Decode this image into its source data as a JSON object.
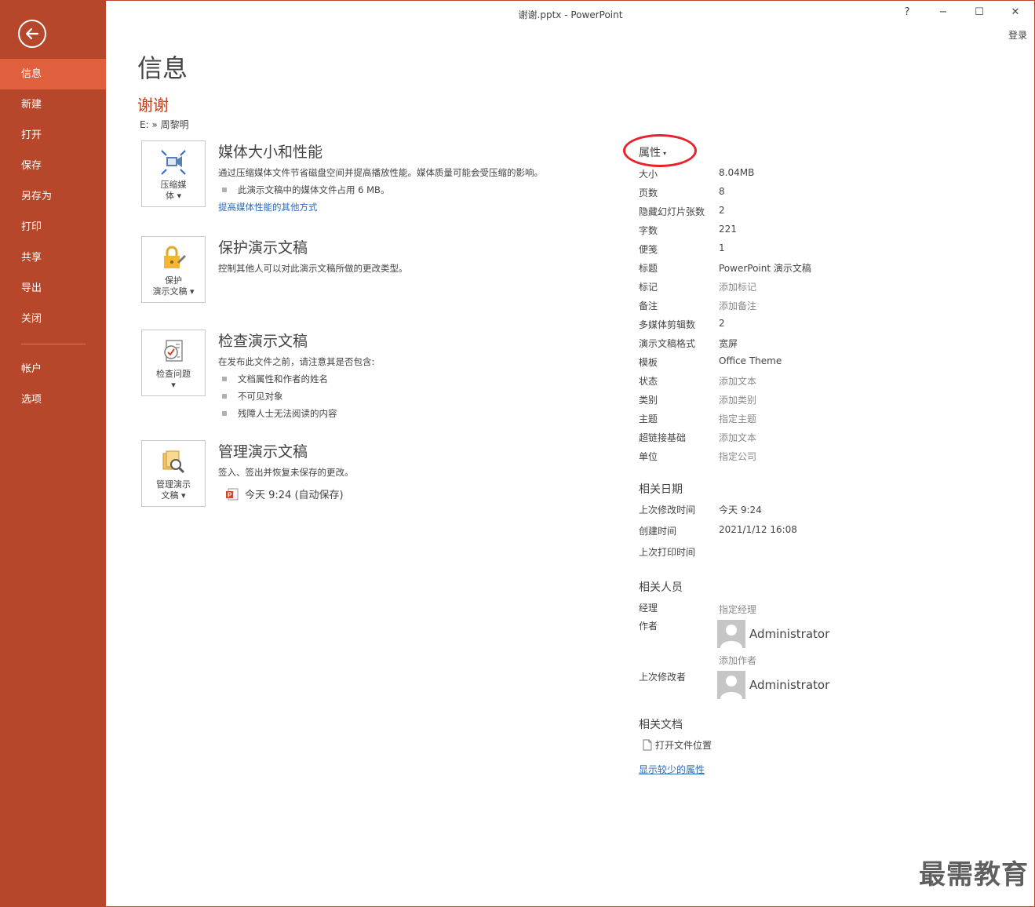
{
  "window": {
    "title": "谢谢.pptx - PowerPoint",
    "help": "?",
    "minimize": "−",
    "maximize": "☐",
    "close": "✕",
    "login": "登录"
  },
  "sidebar": {
    "items": [
      {
        "label": "信息"
      },
      {
        "label": "新建"
      },
      {
        "label": "打开"
      },
      {
        "label": "保存"
      },
      {
        "label": "另存为"
      },
      {
        "label": "打印"
      },
      {
        "label": "共享"
      },
      {
        "label": "导出"
      },
      {
        "label": "关闭"
      }
    ],
    "bottom_items": [
      {
        "label": "帐户"
      },
      {
        "label": "选项"
      }
    ]
  },
  "main": {
    "page_title": "信息",
    "doc_name": "谢谢",
    "doc_path": "E: » 周黎明",
    "sections": {
      "media": {
        "tile_label_1": "压缩媒",
        "tile_label_2": "体 ▾",
        "title": "媒体大小和性能",
        "desc": "通过压缩媒体文件节省磁盘空间并提高播放性能。媒体质量可能会受压缩的影响。",
        "bullet": "此演示文稿中的媒体文件占用 6 MB。",
        "link": "提高媒体性能的其他方式"
      },
      "protect": {
        "tile_label_1": "保护",
        "tile_label_2": "演示文稿 ▾",
        "title": "保护演示文稿",
        "desc": "控制其他人可以对此演示文稿所做的更改类型。"
      },
      "inspect": {
        "tile_label_1": "检查问题",
        "tile_label_2": "▾",
        "title": "检查演示文稿",
        "desc": "在发布此文件之前，请注意其是否包含:",
        "bullets": [
          "文档属性和作者的姓名",
          "不可见对象",
          "残障人士无法阅读的内容"
        ]
      },
      "manage": {
        "tile_label_1": "管理演示",
        "tile_label_2": "文稿 ▾",
        "title": "管理演示文稿",
        "desc": "签入、签出并恢复未保存的更改。",
        "autosave": "今天 9:24 (自动保存)"
      }
    }
  },
  "properties": {
    "header": "属性",
    "caret": "▾",
    "rows": [
      {
        "k": "大小",
        "v": "8.04MB"
      },
      {
        "k": "页数",
        "v": "8"
      },
      {
        "k": "隐藏幻灯片张数",
        "v": "2"
      },
      {
        "k": "字数",
        "v": "221"
      },
      {
        "k": "便笺",
        "v": "1"
      },
      {
        "k": "标题",
        "v": "PowerPoint 演示文稿"
      },
      {
        "k": "标记",
        "v": "添加标记"
      },
      {
        "k": "备注",
        "v": "添加备注"
      },
      {
        "k": "多媒体剪辑数",
        "v": "2"
      },
      {
        "k": "演示文稿格式",
        "v": "宽屏"
      },
      {
        "k": "模板",
        "v": "Office Theme"
      },
      {
        "k": "状态",
        "v": "添加文本"
      },
      {
        "k": "类别",
        "v": "添加类别"
      },
      {
        "k": "主题",
        "v": "指定主题"
      },
      {
        "k": "超链接基础",
        "v": "添加文本"
      },
      {
        "k": "单位",
        "v": "指定公司"
      }
    ],
    "dates": {
      "header": "相关日期",
      "rows": [
        {
          "k": "上次修改时间",
          "v": "今天 9:24"
        },
        {
          "k": "创建时间",
          "v": "2021/1/12 16:08"
        },
        {
          "k": "上次打印时间",
          "v": ""
        }
      ]
    },
    "people": {
      "header": "相关人员",
      "manager_label": "经理",
      "manager_value": "指定经理",
      "author_label": "作者",
      "author_name": "Administrator",
      "add_author": "添加作者",
      "last_modified_label": "上次修改者",
      "last_modified_name": "Administrator"
    },
    "docs": {
      "header": "相关文档",
      "open_location": "打开文件位置",
      "show_fewer": "显示较少的属性"
    }
  },
  "watermark": "最需教育"
}
